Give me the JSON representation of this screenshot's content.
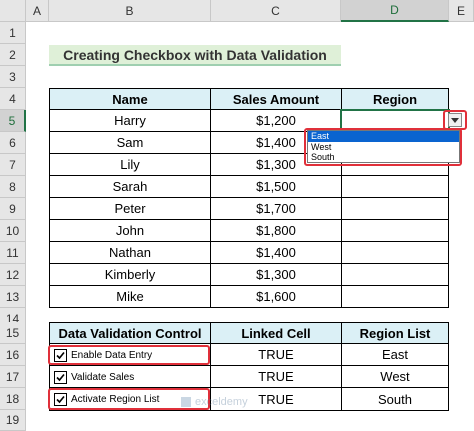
{
  "columns": [
    "A",
    "B",
    "C",
    "D",
    "E"
  ],
  "rows": [
    "1",
    "2",
    "3",
    "4",
    "5",
    "6",
    "7",
    "8",
    "9",
    "10",
    "11",
    "12",
    "13",
    "14",
    "15",
    "16",
    "17",
    "18",
    "19"
  ],
  "title": "Creating Checkbox with Data Validation",
  "sales_table": {
    "headers": [
      "Name",
      "Sales Amount",
      "Region"
    ],
    "rows": [
      {
        "name": "Harry",
        "amount": "$1,200"
      },
      {
        "name": "Sam",
        "amount": "$1,400"
      },
      {
        "name": "Lily",
        "amount": "$1,300"
      },
      {
        "name": "Sarah",
        "amount": "$1,500"
      },
      {
        "name": "Peter",
        "amount": "$1,700"
      },
      {
        "name": "John",
        "amount": "$1,800"
      },
      {
        "name": "Nathan",
        "amount": "$1,400"
      },
      {
        "name": "Kimberly",
        "amount": "$1,300"
      },
      {
        "name": "Mike",
        "amount": "$1,600"
      }
    ]
  },
  "dropdown": {
    "options": [
      "East",
      "West",
      "South"
    ],
    "highlighted": "East"
  },
  "control_table": {
    "headers": [
      "Data Validation Control",
      "Linked Cell",
      "Region List"
    ],
    "rows": [
      {
        "checkbox": "Enable Data Entry",
        "linked": "TRUE",
        "region": "East"
      },
      {
        "checkbox": "Validate Sales",
        "linked": "TRUE",
        "region": "West"
      },
      {
        "checkbox": "Activate Region List",
        "linked": "TRUE",
        "region": "South"
      }
    ]
  },
  "watermark": "exceldemy",
  "colors": {
    "header_fill": "#dbf0f6",
    "title_fill": "#dff0d8",
    "highlight_border": "#e0303a",
    "selection": "#217346"
  }
}
